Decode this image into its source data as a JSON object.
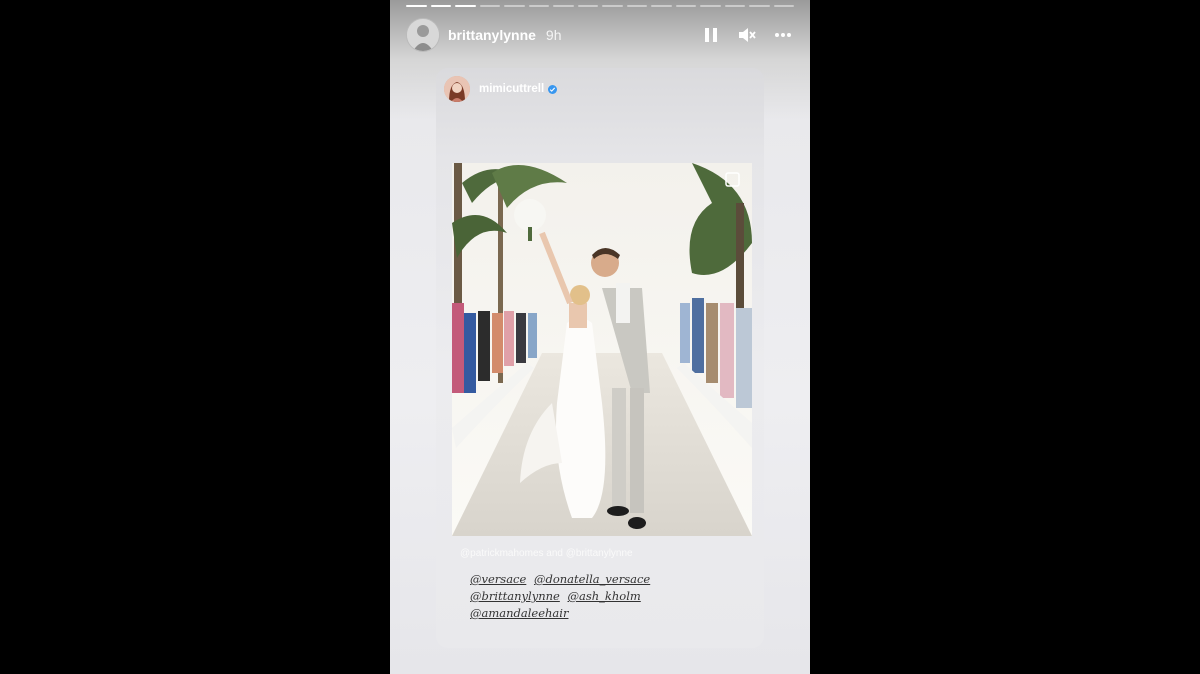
{
  "story": {
    "progress": {
      "total": 16,
      "completed": 3
    },
    "author": {
      "username": "brittanylynne",
      "time": "9h"
    },
    "controls": {
      "pause_icon": "pause-icon",
      "mute_icon": "speaker-muted-icon",
      "more_icon": "more-icon"
    }
  },
  "shared_post": {
    "username": "mimicuttrell",
    "verified": true,
    "photo_tag_line": "@patrickmahomes and @brittanylynne",
    "mentions": [
      "@versace",
      "@donatella_versace",
      "@brittanylynne",
      "@ash_kholm",
      "@amandaleehair"
    ]
  },
  "colors": {
    "background": "#000000",
    "verified_badge": "#3897f0"
  }
}
